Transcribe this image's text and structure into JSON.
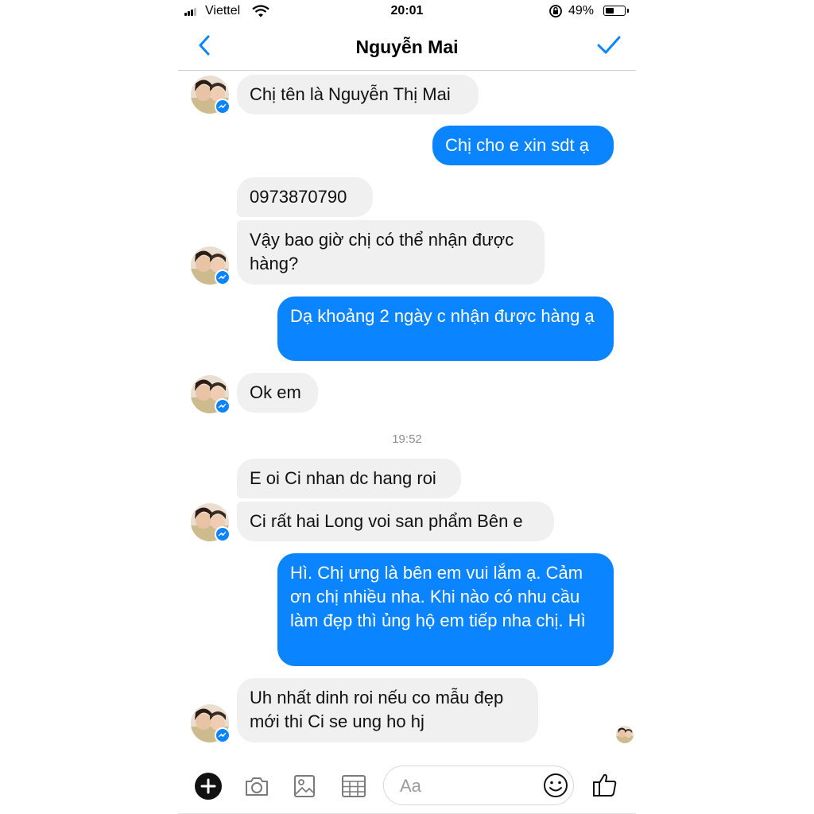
{
  "status_bar": {
    "carrier": "Viettel",
    "time": "20:01",
    "battery": "49%",
    "battery_level": 0.49
  },
  "header": {
    "contact_name": "Nguyễn Mai"
  },
  "messages": [
    {
      "text": "Chị tên là Nguyễn Thị Mai",
      "sender": "them"
    },
    {
      "text": "Chị cho e xin sdt ạ",
      "sender": "me"
    },
    {
      "text": "0973870790",
      "sender": "them"
    },
    {
      "text": "Vậy bao giờ chị có thể nhận được hàng?",
      "sender": "them"
    },
    {
      "text": "Dạ khoảng 2 ngày c nhận được hàng ạ",
      "sender": "me"
    },
    {
      "text": "Ok em",
      "sender": "them"
    },
    {
      "text": "E oi Ci nhan dc hang roi",
      "sender": "them"
    },
    {
      "text": "Ci rất hai Long voi san phẩm Bên e",
      "sender": "them"
    },
    {
      "text": "Hì. Chị ưng là bên em vui lắm ạ. Cảm ơn chị nhiều nha. Khi nào có nhu cầu làm đẹp thì ủng hộ em tiếp nha chị. Hì",
      "sender": "me"
    },
    {
      "text": "Uh nhất dinh roi nếu co mẫu đẹp mới thi Ci se ung ho hj",
      "sender": "them"
    }
  ],
  "timestamp_divider": "19:52",
  "composer": {
    "placeholder": "Aa"
  },
  "icons": {
    "back": "chevron-left-icon",
    "done": "checkmark-icon",
    "add": "plus-circle-icon",
    "camera": "camera-icon",
    "gallery": "photo-icon",
    "sticker": "grid-icon",
    "emoji": "smiley-icon",
    "like": "thumbs-up-icon",
    "badge": "messenger-icon"
  },
  "colors": {
    "accent": "#0a84ff",
    "incoming_bubble": "#f0f0f0",
    "outgoing_bubble": "#0a84ff"
  }
}
